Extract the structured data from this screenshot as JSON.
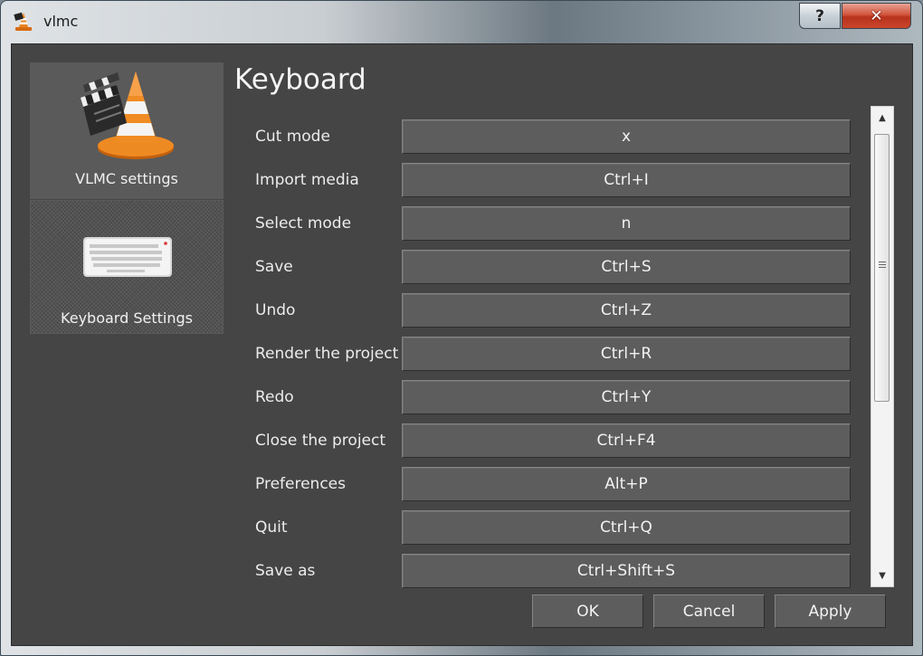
{
  "window": {
    "title": "vlmc",
    "help_glyph": "?",
    "close_glyph": "✕"
  },
  "sidebar": {
    "items": [
      {
        "label": "VLMC settings",
        "icon": "vlc-clapperboard-cone-icon",
        "selected": false
      },
      {
        "label": "Keyboard Settings",
        "icon": "keyboard-icon",
        "selected": true
      }
    ]
  },
  "page": {
    "heading": "Keyboard"
  },
  "shortcuts": [
    {
      "label": "Cut mode",
      "value": "x"
    },
    {
      "label": "Import media",
      "value": "Ctrl+I"
    },
    {
      "label": "Select mode",
      "value": "n"
    },
    {
      "label": "Save",
      "value": "Ctrl+S"
    },
    {
      "label": "Undo",
      "value": "Ctrl+Z"
    },
    {
      "label": "Render the project",
      "value": "Ctrl+R"
    },
    {
      "label": "Redo",
      "value": "Ctrl+Y"
    },
    {
      "label": "Close the project",
      "value": "Ctrl+F4"
    },
    {
      "label": "Preferences",
      "value": "Alt+P"
    },
    {
      "label": "Quit",
      "value": "Ctrl+Q"
    },
    {
      "label": "Save as",
      "value": "Ctrl+Shift+S"
    }
  ],
  "buttons": {
    "ok": "OK",
    "cancel": "Cancel",
    "apply": "Apply"
  },
  "colors": {
    "panel_bg": "#454545",
    "accent_orange": "#e8821e",
    "close_red": "#c9462b"
  }
}
